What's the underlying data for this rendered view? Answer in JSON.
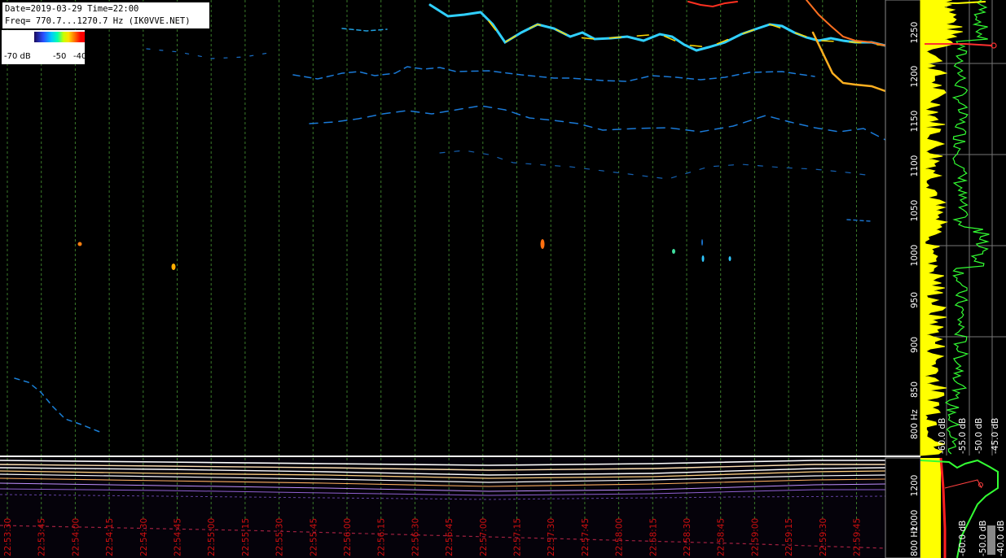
{
  "header": {
    "date_line": "Date=2019-03-29 Time=22:00",
    "freq_line": "Freq= 770.7...1270.7 Hz (IK0VVE.NET)"
  },
  "color_scale": {
    "labels": [
      "-70 dB",
      "-50",
      "-40"
    ]
  },
  "freq_axis": {
    "ticks": [
      "1250",
      "1200",
      "1150",
      "1100",
      "1050",
      "1000",
      "950",
      "900",
      "850",
      "800 Hz"
    ]
  },
  "spectrum_db_axis": {
    "labels": [
      "-45.0 dB",
      "-50.0 dB",
      "-55.0 dB",
      "-60.0 dB"
    ]
  },
  "lower_freq_axis": {
    "ticks": [
      "1200",
      "1000",
      "800 Hz"
    ]
  },
  "lower_db_axis": {
    "labels": [
      "-40.0 dB",
      "-50.0 dB",
      "-60.0 dB"
    ]
  },
  "time_axis": {
    "ticks": [
      "22:53:30",
      "22:53:45",
      "22:54:00",
      "22:54:15",
      "22:54:30",
      "22:54:45",
      "22:55:00",
      "22:55:15",
      "22:55:30",
      "22:55:45",
      "22:56:00",
      "22:56:15",
      "22:56:30",
      "22:56:45",
      "22:57:00",
      "22:57:15",
      "22:57:30",
      "22:57:45",
      "22:58:00",
      "22:58:15",
      "22:58:30",
      "22:58:45",
      "22:59:00",
      "22:59:15",
      "22:59:30",
      "22:59:45"
    ]
  },
  "colors": {
    "gridline": "#3a7a2a",
    "time_label": "#d01010",
    "axis_text": "#ffffff",
    "spectrum_peak": "#ffff00",
    "spectrum_avg": "#33ff33"
  }
}
